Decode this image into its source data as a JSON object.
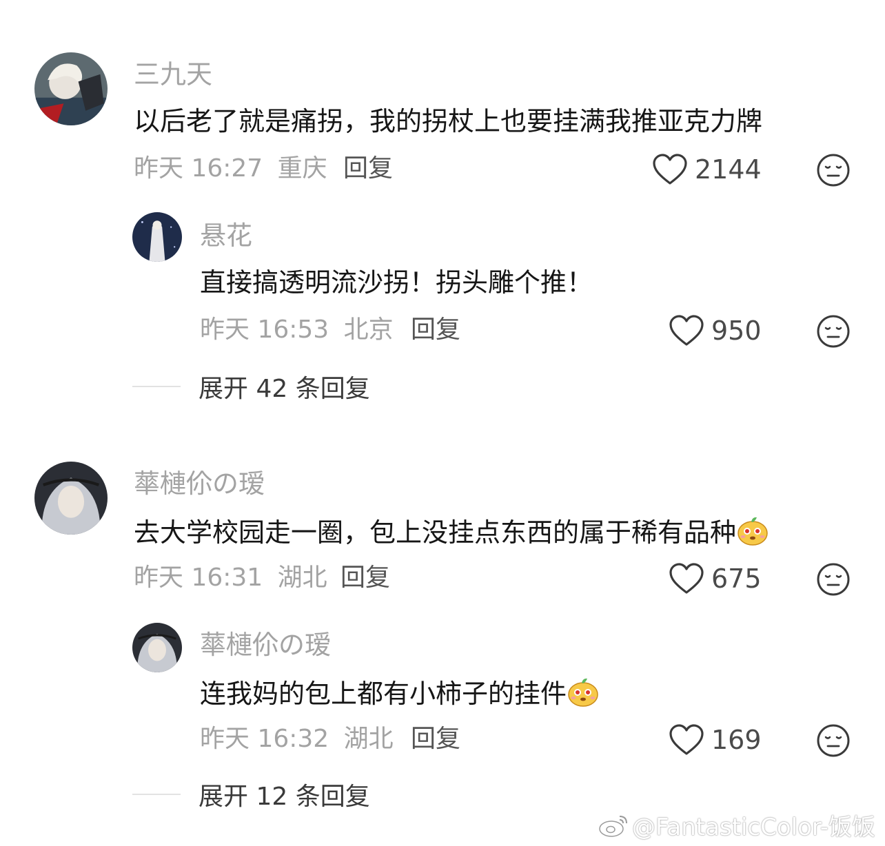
{
  "comments": [
    {
      "username": "三九天",
      "text": "以后老了就是痛拐，我的拐杖上也要挂满我推亚克力牌",
      "time": "昨天 16:27",
      "location": "重庆",
      "reply_label": "回复",
      "likes": "2144",
      "avatar_icon": "avatar-user-icon"
    },
    {
      "username": "悬花",
      "text": "直接搞透明流沙拐！拐头雕个推！",
      "time": "昨天 16:53",
      "location": "北京",
      "reply_label": "回复",
      "likes": "950",
      "avatar_icon": "avatar-user-icon"
    },
    {
      "username": "蕐槤伱の瑷",
      "text": "去大学校园走一圈，包上没挂点东西的属于稀有品种",
      "time": "昨天 16:31",
      "location": "湖北",
      "reply_label": "回复",
      "likes": "675",
      "avatar_icon": "avatar-user-icon"
    },
    {
      "username": "蕐槤伱の瑷",
      "text": "连我妈的包上都有小柿子的挂件",
      "time": "昨天 16:32",
      "location": "湖北",
      "reply_label": "回复",
      "likes": "169",
      "avatar_icon": "avatar-user-icon"
    }
  ],
  "expand_replies": [
    {
      "label": "展开 42 条回复"
    },
    {
      "label": "展开 12 条回复"
    }
  ],
  "icons": {
    "like": "heart-icon",
    "dislike": "dislike-face-icon",
    "emoji": "persimmon-emoji-icon",
    "weibo": "weibo-logo-icon"
  },
  "watermark": "@FantasticColor-饭饭",
  "colors": {
    "text": "#161616",
    "secondary": "#a3a3a3",
    "icon": "#3a3a3a",
    "emoji": "#f7c948"
  }
}
